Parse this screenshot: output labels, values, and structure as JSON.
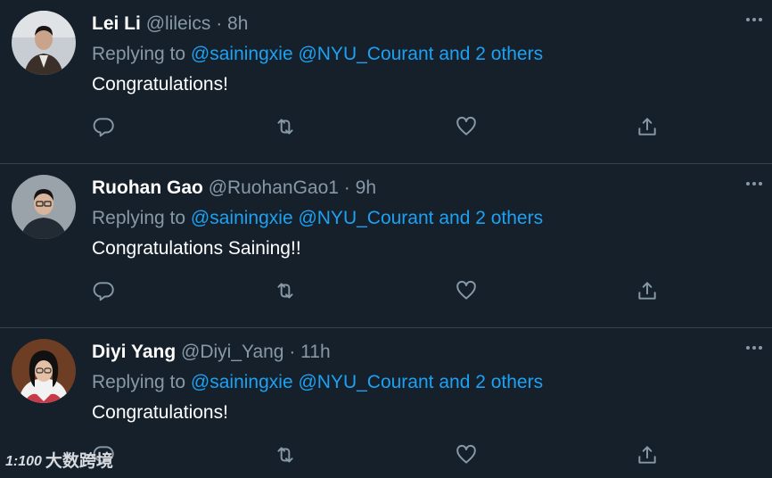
{
  "tweets": [
    {
      "name": "Lei Li",
      "handle": "@lileics",
      "separator": "·",
      "time": "8h",
      "replying_prefix": "Replying to",
      "replying_to": "@sainingxie @NYU_Courant and 2 others",
      "text": "Congratulations!",
      "avatar_bg": "#a9b3bb"
    },
    {
      "name": "Ruohan Gao",
      "handle": "@RuohanGao1",
      "separator": "·",
      "time": "9h",
      "replying_prefix": "Replying to",
      "replying_to": "@sainingxie @NYU_Courant and 2 others",
      "text": "Congratulations Saining!!",
      "avatar_bg": "#8f99a1"
    },
    {
      "name": "Diyi Yang",
      "handle": "@Diyi_Yang",
      "separator": "·",
      "time": "11h",
      "replying_prefix": "Replying to",
      "replying_to": "@sainingxie @NYU_Courant and 2 others",
      "text": "Congratulations!",
      "avatar_bg": "#7a4a2e"
    }
  ],
  "icons": {
    "reply": "reply-icon",
    "retweet": "retweet-icon",
    "like": "heart-icon",
    "share": "share-icon",
    "more": "more-icon"
  },
  "colors": {
    "background": "#15202b",
    "link": "#1da1f2",
    "muted": "#8899a6",
    "divider": "#38444d"
  },
  "watermark": {
    "logo": "1:100",
    "text": "大数跨境"
  }
}
